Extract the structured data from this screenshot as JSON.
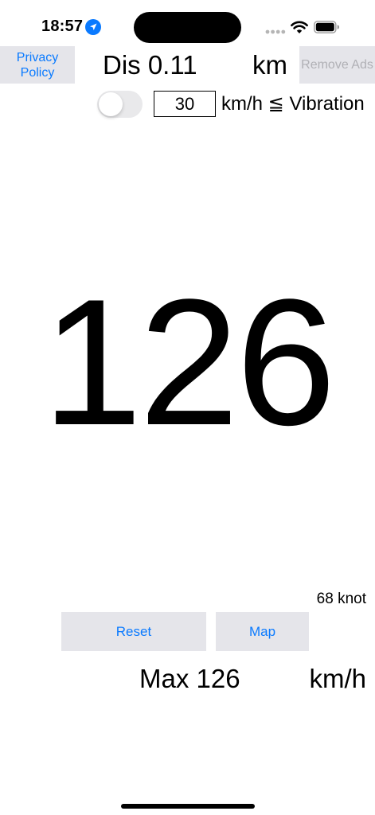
{
  "status_bar": {
    "time": "18:57",
    "icons": [
      "location-arrow-icon",
      "signal-dots-icon",
      "wifi-icon",
      "battery-icon"
    ]
  },
  "header": {
    "privacy_label": "Privacy Policy",
    "distance_label": "Dis 0.11",
    "distance_unit": "km",
    "remove_ads_label": "Remove Ads"
  },
  "vibration": {
    "enabled": false,
    "threshold_value": "30",
    "label": "km/h ≦ Vibration"
  },
  "speedometer": {
    "speed": "126",
    "knot_label": "68 knot"
  },
  "actions": {
    "reset_label": "Reset",
    "map_label": "Map"
  },
  "footer": {
    "max_label": "Max 126",
    "max_unit": "km/h"
  },
  "colors": {
    "accent": "#0a7aff",
    "button_bg": "#e5e5ea",
    "disabled_text": "#b0b0b5"
  }
}
